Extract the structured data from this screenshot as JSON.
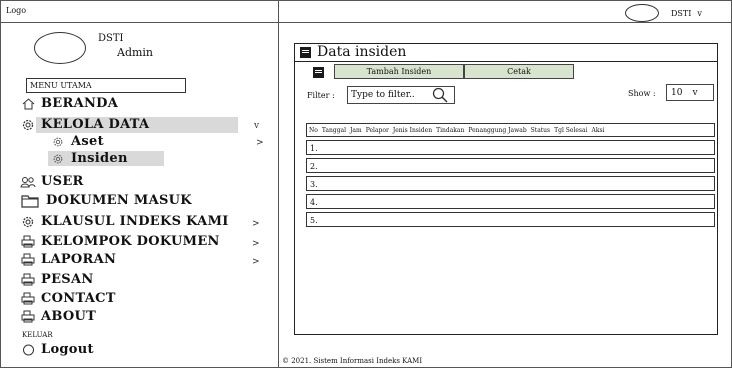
{
  "header": {
    "logo": "Logo",
    "user_label": "DSTI",
    "user_caret": "v"
  },
  "sidebar": {
    "profile_name": "DSTI",
    "profile_role": "Admin",
    "menu_title": "MENU UTAMA",
    "items": [
      {
        "label": "BERANDA",
        "icon": "home-icon"
      },
      {
        "label": "KELOLA DATA",
        "icon": "gear-icon",
        "chevron": "v"
      },
      {
        "label": "Aset",
        "icon": "gear-icon",
        "chevron": ">"
      },
      {
        "label": "Insiden",
        "icon": "gear-icon"
      },
      {
        "label": "USER",
        "icon": "users-icon"
      },
      {
        "label": "DOKUMEN MASUK",
        "icon": "folder-icon"
      },
      {
        "label": "KLAUSUL INDEKS KAMI",
        "icon": "gear-icon",
        "chevron": ">"
      },
      {
        "label": "KELOMPOK DOKUMEN",
        "icon": "printer-icon",
        "chevron": ">"
      },
      {
        "label": "LAPORAN",
        "icon": "printer-icon",
        "chevron": ">"
      },
      {
        "label": "PESAN",
        "icon": "printer-icon"
      },
      {
        "label": "CONTACT",
        "icon": "printer-icon"
      },
      {
        "label": "ABOUT",
        "icon": "printer-icon"
      }
    ],
    "section_keluar": "KELUAR",
    "logout": {
      "label": "Logout",
      "icon": "power-icon"
    }
  },
  "main": {
    "title": "Data insiden",
    "add_button": "Tambah Insiden",
    "print_button": "Cetak",
    "filter_label": "Filter :",
    "filter_placeholder": "Type to filter..",
    "show_label": "Show :",
    "show_value": "10",
    "show_caret": "v",
    "table": {
      "columns": [
        "No",
        "Tanggal",
        "Jam",
        "Pelapor",
        "Jenis Insiden",
        "Tindakan",
        "Penanggung Jawab",
        "Status",
        "Tgl Selesai",
        "Aksi"
      ],
      "rows": [
        "1.",
        "2.",
        "3.",
        "4.",
        "5."
      ]
    }
  },
  "footer": {
    "text": "© 2021. Sistem Informasi Indeks KAMI"
  }
}
